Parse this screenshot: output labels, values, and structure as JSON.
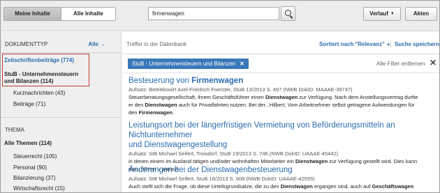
{
  "toolbar": {
    "tab_mine": "Meine Inhalte",
    "tab_all": "Alle Inhalte",
    "search_value": "firmenwagen",
    "verlauf_label": "Verlauf",
    "akten_label": "Akten"
  },
  "sidebar": {
    "doctype_heading": "DOKUMENTTYP",
    "alle_link": "Alle",
    "items": [
      {
        "label": "Zeitschriftenbeiträge (774)"
      },
      {
        "label": "StuB - Unternehmensteuern und Bilanzen (114)"
      },
      {
        "label": "Kurznachrichten (43)"
      },
      {
        "label": "Beiträge (71)"
      }
    ],
    "thema_heading": "THEMA",
    "thema_all": "Alle Themen (114)",
    "thema_items": [
      {
        "label": "Steuerrecht (105)"
      },
      {
        "label": "Personal (90)"
      },
      {
        "label": "Bilanzierung (37)"
      },
      {
        "label": "Wirtschaftsrecht (15)"
      }
    ]
  },
  "main": {
    "treffer_label": "Treffer in der Datenbank",
    "sort_label": "Sortiert nach \"Relevanz\"",
    "sort_sep": "|",
    "save_label": "Suche speichern",
    "active_filter": "StuB - Unternehmensteuern und Bilanzen",
    "clear_filters": "Alle Filter entfernen",
    "results": [
      {
        "title_pre": "Besteuerung von ",
        "title_hl": "Firmenwagen",
        "meta": "Aufsatz: Betriebswirt Axel-Friedrich Foerster, StuB 13/2013 S. 497 (NWB DokID: MAAAE-39747)",
        "line1_a": "Steuerberatungsgesellschaft, ihrem Geschäftsführer einen ",
        "line1_hl": "Dienstwagen",
        "line1_b": " zur Verfügung. Nach dem Anstellungsvertrag durfte",
        "line2_a": "er den ",
        "line2_hl": "Dienstwagen",
        "line2_b": " auch für Privatfahrten nutzen. Bei der...Hilbert, Vom Arbeitnehmer selbst getragene Aufwendungen für",
        "line3_a": "den ",
        "line3_hl": "Firmenwagen",
        "line3_b": "."
      },
      {
        "title_line1": "Leistungsort bei der längerfristigen Vermietung von Beförderungsmitteln an Nichtunternehmer",
        "title_line2": "und Dienstwagengestellung",
        "meta": "Aufsatz: StB Michael Seifert, Troisdorf, StuB 19/2013 S. 746 (NWB DokID: UAAAE-45442)",
        "line1_a": "in denen einem im Ausland tätigen und/oder wohnhaften Mitarbeiter ein ",
        "line1_hl": "Dienstwagen",
        "line1_b": " zur Verfügung gestellt wird. Dies kann",
        "line2": "dazu führen – worauf"
      },
      {
        "title": "Änderungen bei der Dienstwagenbesteuerung",
        "meta": "Aufsatz: StB Michael Seifert, StuB 16/2013 S. 608 (NWB DokID: UAAAE-42555)",
        "line1_a": "Auch stellt sich die Frage, ob diese Urteilsgrundsätze, die zu den ",
        "line1_hl": "Dienstwagen",
        "line1_b": " ergangen sind, auch auf ",
        "line1_hl2": "Geschäftswagen"
      }
    ]
  }
}
